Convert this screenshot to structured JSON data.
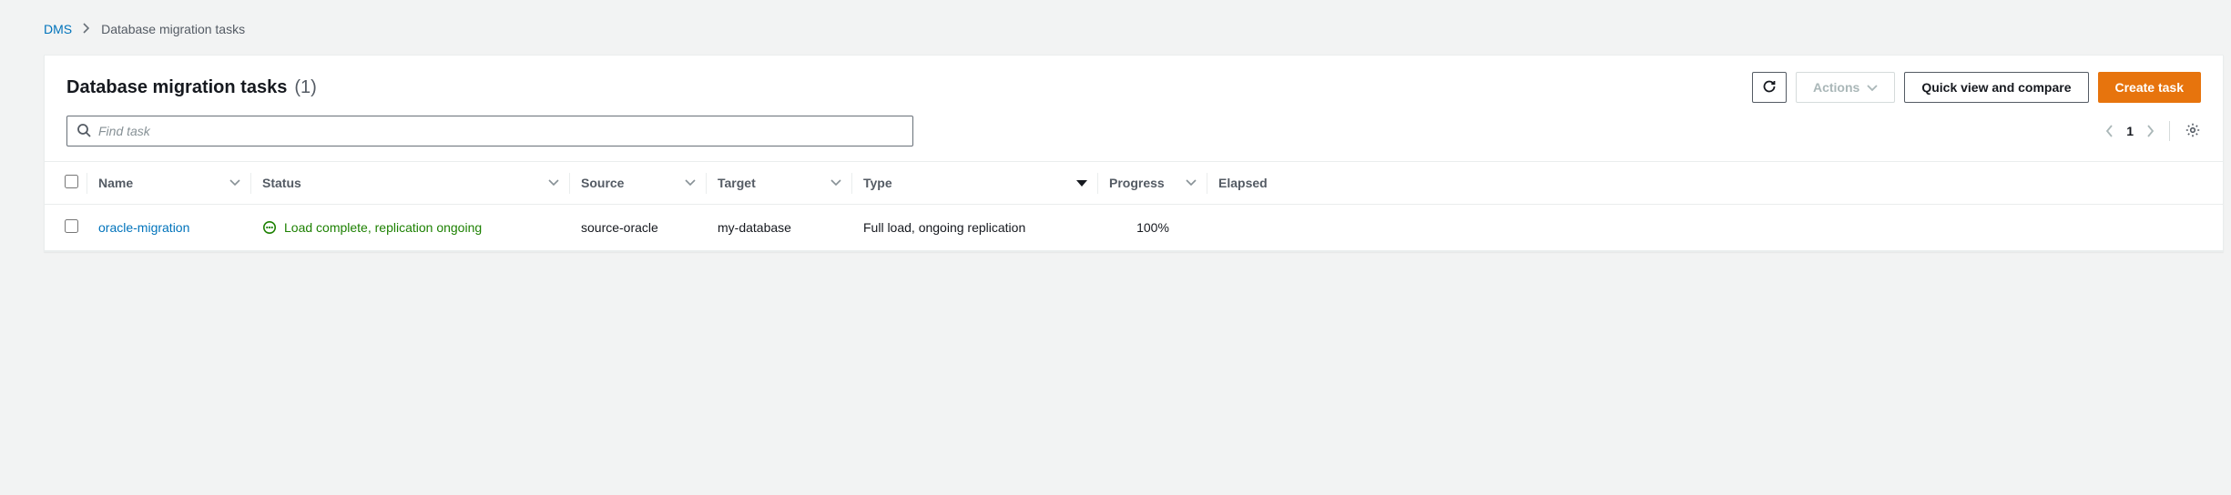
{
  "breadcrumb": {
    "root": "DMS",
    "current": "Database migration tasks"
  },
  "header": {
    "title": "Database migration tasks",
    "count": "(1)",
    "actions_label": "Actions",
    "quick_view_label": "Quick view and compare",
    "create_label": "Create task"
  },
  "search": {
    "placeholder": "Find task"
  },
  "pager": {
    "page": "1"
  },
  "columns": {
    "name": "Name",
    "status": "Status",
    "source": "Source",
    "target": "Target",
    "type": "Type",
    "progress": "Progress",
    "elapsed": "Elapsed"
  },
  "rows": [
    {
      "name": "oracle-migration",
      "status": "Load complete, replication ongoing",
      "source": "source-oracle",
      "target": "my-database",
      "type": "Full load, ongoing replication",
      "progress": "100%"
    }
  ]
}
